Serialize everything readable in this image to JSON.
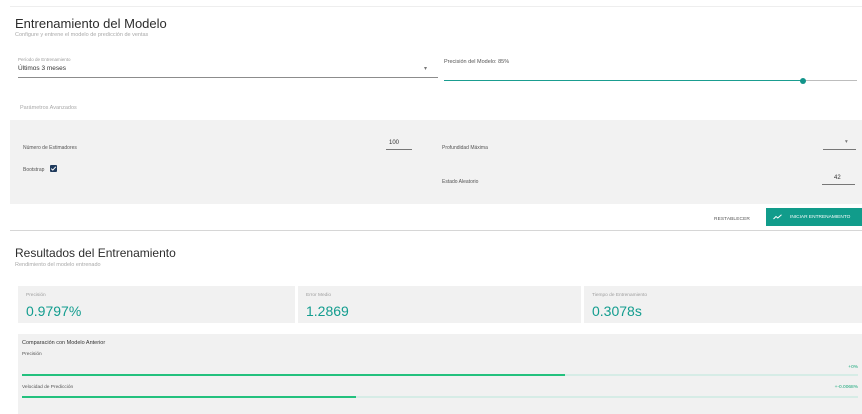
{
  "training": {
    "title": "Entrenamiento del Modelo",
    "subtitle": "Configure y entrene el modelo de predicción de ventas",
    "period": {
      "label": "Período de Entrenamiento",
      "value": "Últimos 3 meses"
    },
    "precision_slider": {
      "label": "Precisión del Modelo: 85%",
      "value_fraction": 0.87
    },
    "advanced": {
      "label": "Parámetros Avanzados",
      "estimators": {
        "label": "Número de Estimadores",
        "value": "100"
      },
      "max_depth": {
        "label": "Profundidad Máxima",
        "value": ""
      },
      "bootstrap": {
        "label": "Bootstrap",
        "checked": true
      },
      "random_state": {
        "label": "Estado Aleatorio",
        "value": "42"
      }
    },
    "reset_label": "RESTABLECER",
    "start_label": "INICIAR ENTRENAMIENTO",
    "accent_color": "#119c8b"
  },
  "results": {
    "title": "Resultados del Entrenamiento",
    "subtitle": "Rendimiento del modelo entrenado",
    "metrics": [
      {
        "label": "Precisión",
        "value": "0.9797%"
      },
      {
        "label": "Error Medio",
        "value": "1.2869"
      },
      {
        "label": "Tiempo de Entrenamiento",
        "value": "0.3078s"
      }
    ],
    "comparison": {
      "title": "Comparación con Modelo Anterior",
      "rows": [
        {
          "label": "Precisión",
          "delta": "+0%",
          "fraction": 0.65
        },
        {
          "label": "Velocidad de Predicción",
          "delta": "+-0.0068%",
          "fraction": 0.4
        }
      ]
    }
  }
}
